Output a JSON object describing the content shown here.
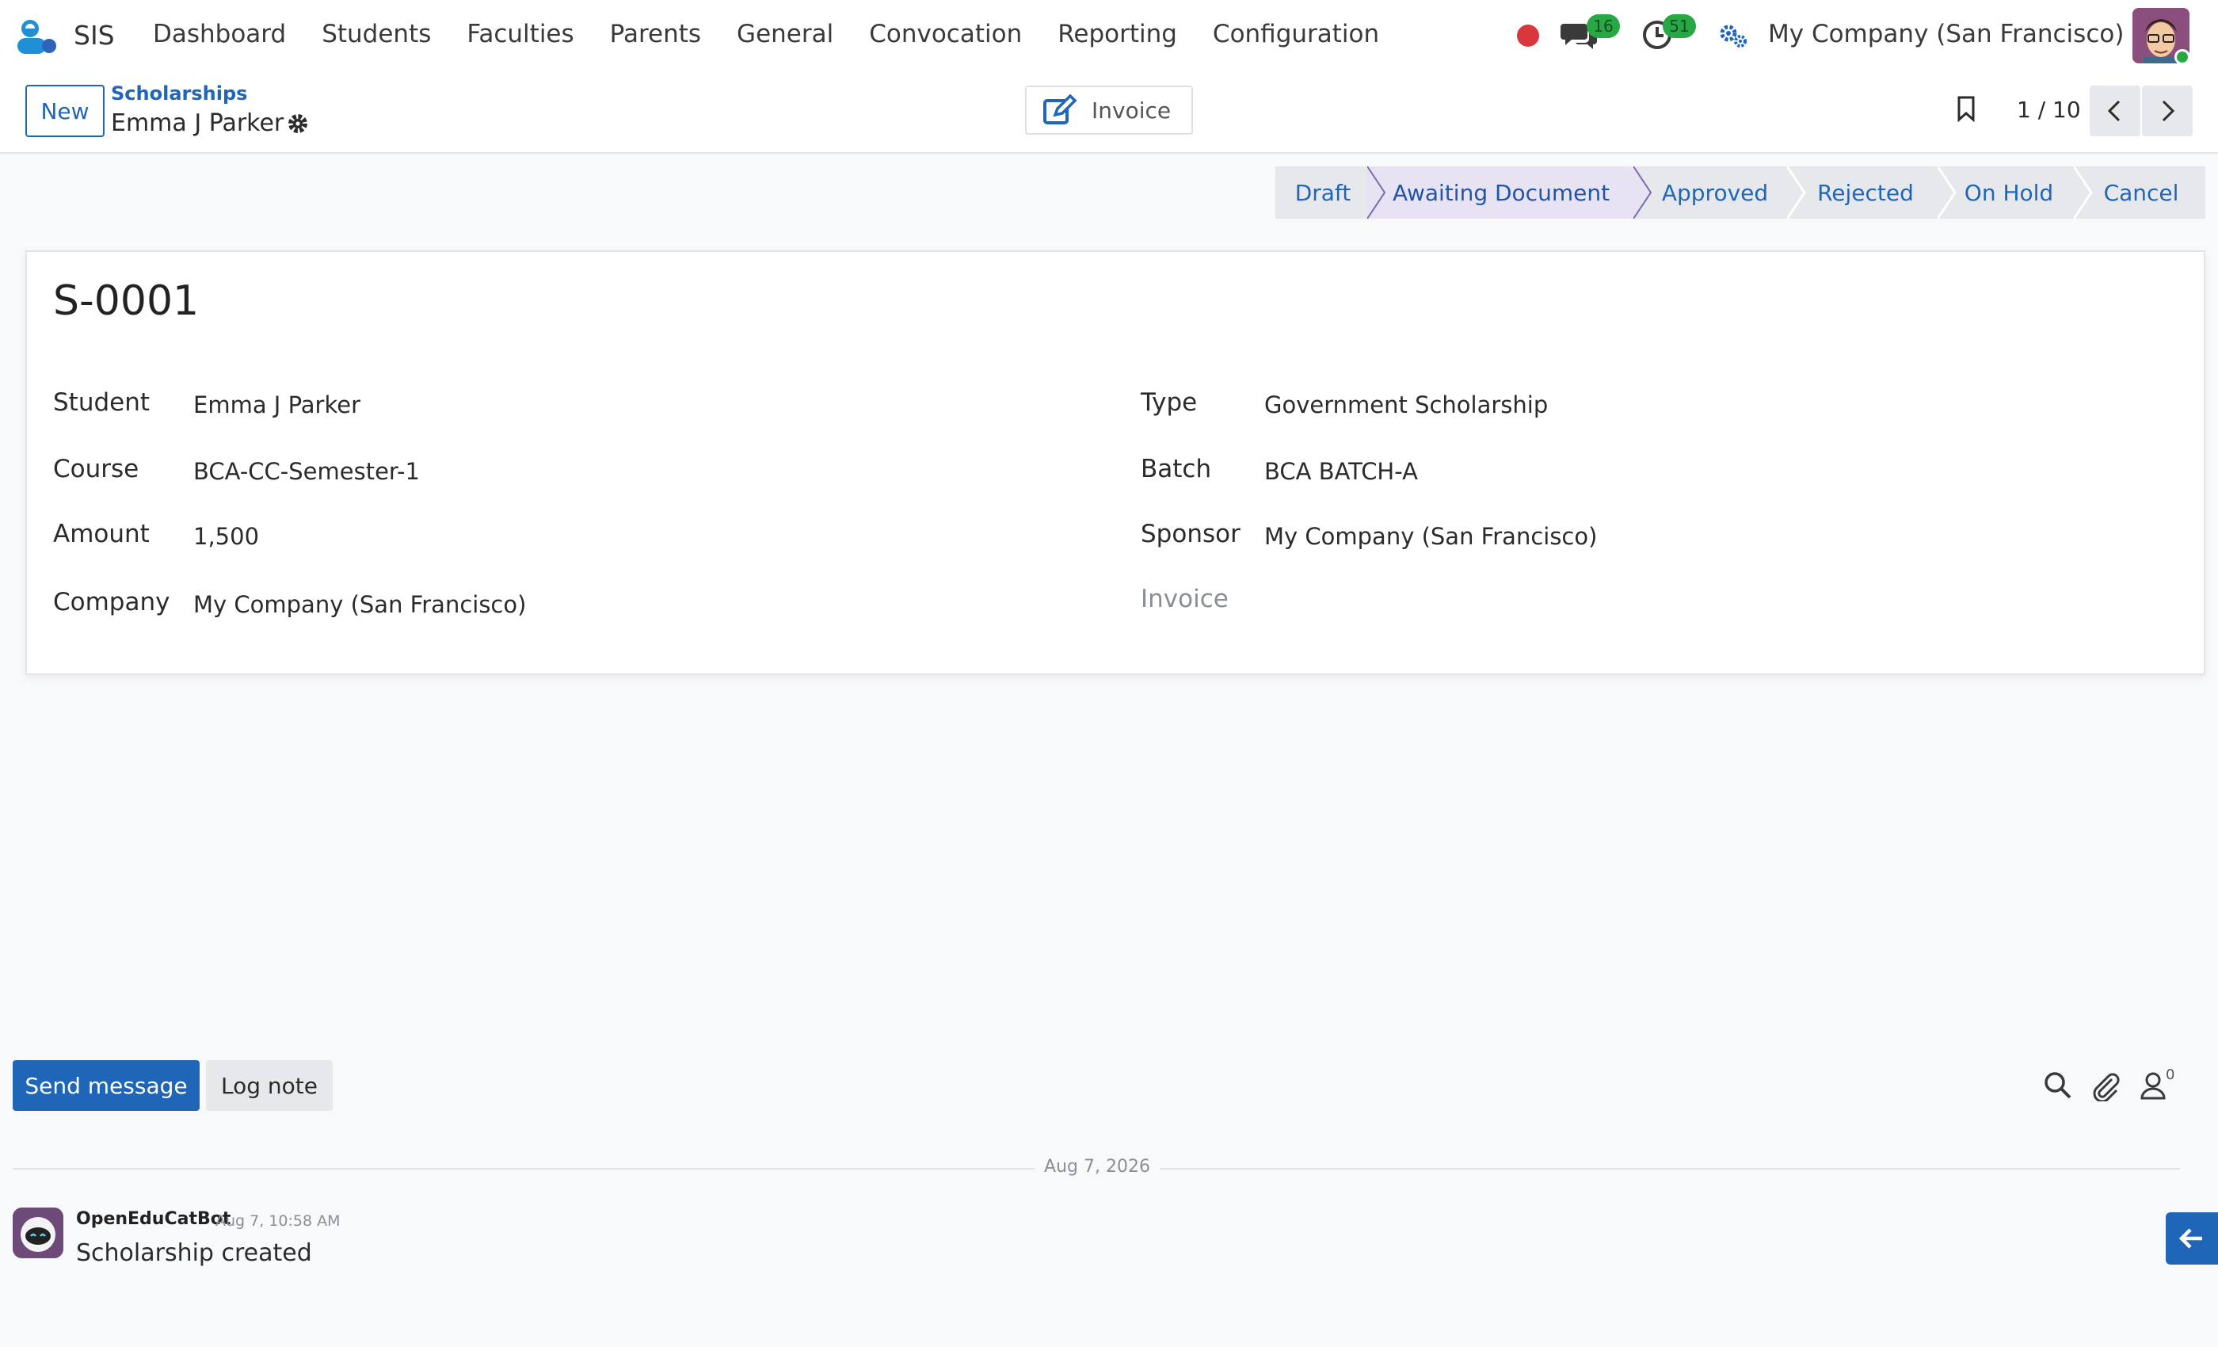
{
  "app": {
    "name": "SIS",
    "menu": [
      "Dashboard",
      "Students",
      "Faculties",
      "Parents",
      "General",
      "Convocation",
      "Reporting",
      "Configuration"
    ]
  },
  "systray": {
    "messages_count": "16",
    "activities_count": "51",
    "company": "My Company (San Francisco)"
  },
  "control": {
    "new_label": "New",
    "breadcrumb_parent": "Scholarships",
    "breadcrumb_current": "Emma J Parker",
    "invoice_label": "Invoice",
    "pager": "1 / 10"
  },
  "statusbar": {
    "stages": [
      "Draft",
      "Awaiting Document",
      "Approved",
      "Rejected",
      "On Hold",
      "Cancel"
    ],
    "active": "Awaiting Document"
  },
  "form": {
    "title": "S-0001",
    "left_fields": [
      {
        "label": "Student",
        "value": "Emma J Parker"
      },
      {
        "label": "Course",
        "value": "BCA-CC-Semester-1"
      },
      {
        "label": "Amount",
        "value": "1,500"
      },
      {
        "label": "Company",
        "value": "My Company (San Francisco)"
      }
    ],
    "right_fields": [
      {
        "label": "Type",
        "value": "Government Scholarship"
      },
      {
        "label": "Batch",
        "value": "BCA BATCH-A"
      },
      {
        "label": "Sponsor",
        "value": "My Company (San Francisco)"
      },
      {
        "label": "Invoice",
        "value": ""
      }
    ]
  },
  "chatter": {
    "send_message_label": "Send message",
    "log_note_label": "Log note",
    "followers_count": "0",
    "date_separator": "Aug 7, 2026",
    "messages": [
      {
        "author": "OpenEduCatBot",
        "time": "Aug 7, 10:58 AM",
        "body": "Scholarship created"
      }
    ]
  },
  "colors": {
    "accent": "#1f66b8",
    "badge_green": "#28a745",
    "record_red": "#d9363e",
    "active_stage_bg": "#e7e3f3"
  },
  "icons": [
    "app-logo-icon",
    "chat-icon",
    "clock-icon",
    "settings-icon",
    "gear-icon",
    "edit-icon",
    "bookmark-icon",
    "chevron-left-icon",
    "chevron-right-icon",
    "search-icon",
    "paperclip-icon",
    "user-icon",
    "arrow-left-icon"
  ]
}
